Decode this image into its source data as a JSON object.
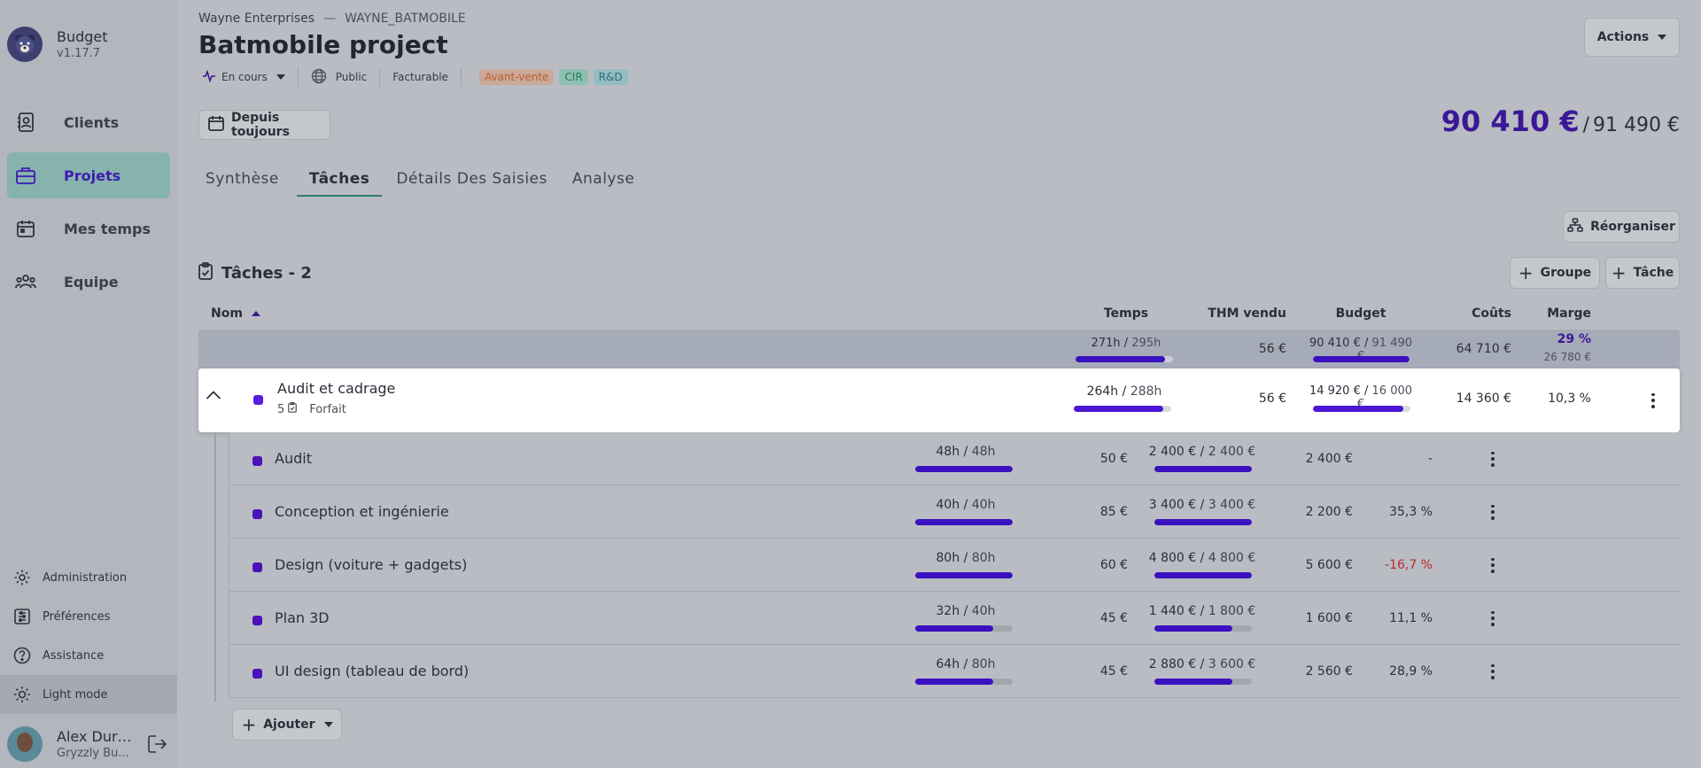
{
  "app": {
    "name": "Budget",
    "version": "v1.17.7"
  },
  "nav": [
    {
      "label": "Clients",
      "icon": "contact-book-icon",
      "active": false
    },
    {
      "label": "Projets",
      "icon": "briefcase-icon",
      "active": true
    },
    {
      "label": "Mes temps",
      "icon": "calendar-icon",
      "active": false
    },
    {
      "label": "Equipe",
      "icon": "team-icon",
      "active": false
    }
  ],
  "bottom_nav": [
    {
      "label": "Administration",
      "icon": "gear-icon"
    },
    {
      "label": "Préférences",
      "icon": "sliders-icon"
    },
    {
      "label": "Assistance",
      "icon": "help-circle-icon"
    },
    {
      "label": "Light mode",
      "icon": "sun-icon"
    }
  ],
  "user": {
    "name": "Alex Dura...",
    "org": "Gryzzly Bu..."
  },
  "breadcrumb": {
    "company": "Wayne Enterprises",
    "separator": "—",
    "code": "WAYNE_BATMOBILE"
  },
  "project": {
    "title": "Batmobile project",
    "status": "En cours",
    "visibility": "Public",
    "billing": "Facturable",
    "tags": [
      "Avant-vente",
      "CIR",
      "R&D"
    ]
  },
  "actions_label": "Actions",
  "period_label": "Depuis toujours",
  "total": {
    "amount": "90 410 €",
    "separator": "/",
    "budget": "91 490 €"
  },
  "tabs": [
    {
      "label": "Synthèse",
      "active": false
    },
    {
      "label": "Tâches",
      "active": true
    },
    {
      "label": "Détails Des Saisies",
      "active": false
    },
    {
      "label": "Analyse",
      "active": false
    }
  ],
  "reorganize_label": "Réorganiser",
  "tasks": {
    "title": "Tâches - 2",
    "group_label": "Groupe",
    "task_label": "Tâche",
    "add_label": "Ajouter"
  },
  "columns": {
    "name": "Nom",
    "time": "Temps",
    "thm": "THM vendu",
    "budget": "Budget",
    "costs": "Coûts",
    "margin": "Marge"
  },
  "summary": {
    "time_done": "271h",
    "time_total": "295h",
    "time_ratio": 0.92,
    "thm": "56 €",
    "budget_done": "90 410 €",
    "budget_total": "91 490 €",
    "budget_ratio": 0.99,
    "costs": "64 710 €",
    "margin_pct": "29 %",
    "margin_value": "26 780 €"
  },
  "group": {
    "name": "Audit et cadrage",
    "count": "5",
    "type": "Forfait",
    "time_done": "264h",
    "time_total": "288h",
    "time_ratio": 0.92,
    "thm": "56 €",
    "budget_done": "14 920 €",
    "budget_total": "16 000 €",
    "budget_ratio": 0.93,
    "costs": "14 360 €",
    "margin": "10,3 %"
  },
  "rows": [
    {
      "name": "Audit",
      "time_done": "48h",
      "time_total": "48h",
      "time_ratio": 1.0,
      "thm": "50 €",
      "budget_done": "2 400 €",
      "budget_total": "2 400 €",
      "budget_ratio": 1.0,
      "costs": "2 400 €",
      "margin": "-",
      "negative": false
    },
    {
      "name": "Conception et ingénierie",
      "time_done": "40h",
      "time_total": "40h",
      "time_ratio": 1.0,
      "thm": "85 €",
      "budget_done": "3 400 €",
      "budget_total": "3 400 €",
      "budget_ratio": 1.0,
      "costs": "2 200 €",
      "margin": "35,3 %",
      "negative": false
    },
    {
      "name": "Design (voiture + gadgets)",
      "time_done": "80h",
      "time_total": "80h",
      "time_ratio": 1.0,
      "thm": "60 €",
      "budget_done": "4 800 €",
      "budget_total": "4 800 €",
      "budget_ratio": 1.0,
      "costs": "5 600 €",
      "margin": "-16,7 %",
      "negative": true
    },
    {
      "name": "Plan 3D",
      "time_done": "32h",
      "time_total": "40h",
      "time_ratio": 0.8,
      "thm": "45 €",
      "budget_done": "1 440 €",
      "budget_total": "1 800 €",
      "budget_ratio": 0.8,
      "costs": "1 600 €",
      "margin": "11,1 %",
      "negative": false
    },
    {
      "name": "UI design (tableau de bord)",
      "time_done": "64h",
      "time_total": "80h",
      "time_ratio": 0.8,
      "thm": "45 €",
      "budget_done": "2 880 €",
      "budget_total": "3 600 €",
      "budget_ratio": 0.8,
      "costs": "2 560 €",
      "margin": "28,9 %",
      "negative": false
    }
  ],
  "colors": {
    "accent": "#3b1896",
    "active_nav": "#86b4ad",
    "negative": "#c0282f"
  }
}
